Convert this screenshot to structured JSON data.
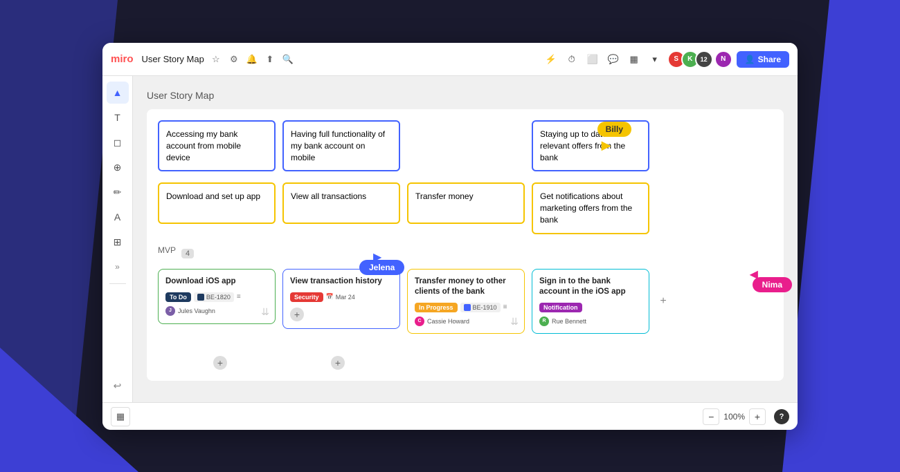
{
  "app": {
    "name": "miro",
    "title": "User Story Map",
    "zoom": "100%"
  },
  "toolbar": {
    "title": "User Story Map",
    "share_label": "Share",
    "avatar_count": "12"
  },
  "canvas": {
    "title": "User Story Map",
    "mvp_label": "MVP",
    "mvp_count": "4"
  },
  "stories": [
    {
      "text": "Accessing my bank account from mobile device",
      "type": "blue"
    },
    {
      "text": "Having full functionality of my bank account on mobile",
      "type": "blue"
    },
    {
      "text": "",
      "type": "gap"
    },
    {
      "text": "Staying up to date with relevant offers from the bank",
      "type": "blue"
    }
  ],
  "tasks_row1": [
    {
      "text": "Download and set up app",
      "type": "yellow"
    },
    {
      "text": "View all transactions",
      "type": "yellow"
    },
    {
      "text": "Transfer money",
      "type": "yellow"
    },
    {
      "text": "Get notifications about marketing offers from the bank",
      "type": "yellow"
    }
  ],
  "task_cards": [
    {
      "title": "Download iOS app",
      "border": "green",
      "badge": "To Do",
      "badge_type": "todo",
      "ticket": "BE-1820",
      "ticket_type": "dark",
      "assignee": "Jules Vaughn",
      "assignee_color": "#7b5ea7"
    },
    {
      "title": "View transaction history",
      "border": "blue-t",
      "badge": "Security",
      "badge_type": "security",
      "date": "Mar 24",
      "assignee": null
    },
    {
      "title": "Transfer money to other clients of the bank",
      "border": "yellow-t",
      "badge": "In Progress",
      "badge_type": "in-progress",
      "ticket": "BE-1910",
      "ticket_type": "blue",
      "assignee": "Cassie Howard",
      "assignee_color": "#e91e8c"
    },
    {
      "title": "Sign in to the bank account in the iOS app",
      "border": "teal",
      "badge": "Notification",
      "badge_type": "notification",
      "assignee": "Rue Bennett",
      "assignee_color": "#4caf50"
    }
  ],
  "cursors": {
    "billy": "Billy",
    "jelena": "Jelena",
    "nima": "Nima"
  },
  "sidebar_icons": [
    "▲",
    "T",
    "◻",
    "⊕",
    "✏",
    "A",
    "⊞",
    "»"
  ],
  "zoom_minus": "−",
  "zoom_plus": "+",
  "help": "?"
}
